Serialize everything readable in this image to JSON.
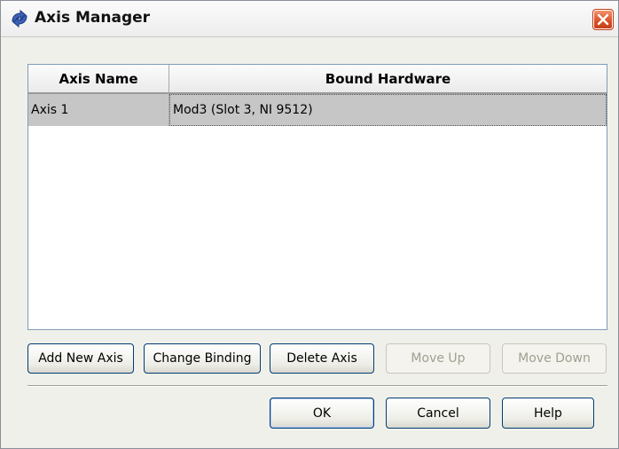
{
  "window": {
    "title": "Axis Manager",
    "icon": "axis-manager-icon",
    "close_icon": "close-icon"
  },
  "table": {
    "columns": [
      "Axis Name",
      "Bound Hardware"
    ],
    "rows": [
      {
        "axis_name": "Axis 1",
        "bound_hardware": "Mod3 (Slot 3, NI 9512)",
        "selected": true
      }
    ]
  },
  "actions": {
    "add_new_axis": "Add New Axis",
    "change_binding": "Change Binding",
    "delete_axis": "Delete Axis",
    "move_up": "Move Up",
    "move_down": "Move Down"
  },
  "dialog_buttons": {
    "ok": "OK",
    "cancel": "Cancel",
    "help": "Help"
  },
  "colors": {
    "selected_row": "#c6c6c6",
    "close_button": "#d9552a",
    "button_border": "#003c74"
  }
}
